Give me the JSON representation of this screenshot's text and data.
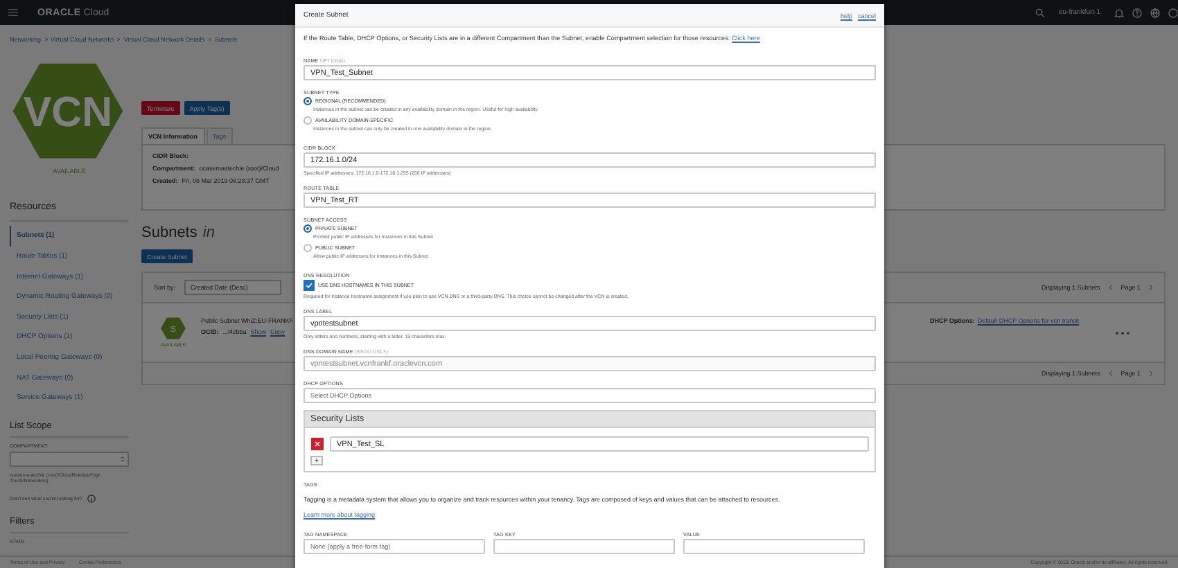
{
  "top_bar": {
    "logo_brand": "ORACLE",
    "logo_product": "Cloud",
    "region": "eu-frankfurt-1"
  },
  "breadcrumb": [
    "Networking",
    "Virtual Cloud Networks",
    "Virtual Cloud Network Details",
    "Subnets"
  ],
  "vcn": {
    "badge": "VCN",
    "status": "AVAILABLE",
    "actions": [
      {
        "label": "Terminate",
        "kind": "danger"
      },
      {
        "label": "Apply Tag(s)",
        "kind": "primary"
      }
    ],
    "tabs": [
      {
        "label": "VCN Information",
        "selected": true
      },
      {
        "label": "Tags",
        "selected": false
      }
    ],
    "info": [
      {
        "label": "CIDR Block:"
      },
      {
        "label": "Compartment:",
        "value": "ocasemastechie (root)/Cloud"
      },
      {
        "label": "Created:",
        "value": "Fri, 08 Mar 2019 08:28:37 GMT"
      }
    ]
  },
  "resources": {
    "title": "Resources",
    "items": [
      {
        "label": "Subnets (1)",
        "selected": true
      },
      {
        "label": "Route Tables (1)",
        "selected": false
      },
      {
        "label": "Internet Gateways (1)",
        "selected": false
      },
      {
        "label": "Dynamic Routing Gateways (0)",
        "selected": false
      },
      {
        "label": "Security Lists (1)",
        "selected": false
      },
      {
        "label": "DHCP Options (1)",
        "selected": false
      },
      {
        "label": "Local Peering Gateways (0)",
        "selected": false
      },
      {
        "label": "NAT Gateways (0)",
        "selected": false
      },
      {
        "label": "Service Gateways (1)",
        "selected": false
      }
    ]
  },
  "list_scope": {
    "title": "List Scope",
    "field_label": "COMPARTMENT",
    "hint": "ocasemastechie (root)/CloudRelease/High Touch/Networking",
    "help": "Don't see what you're looking for?"
  },
  "filters": {
    "title": "Filters",
    "field_label": "STATE"
  },
  "subnets": {
    "title": "Subnets",
    "title_suffix": "in",
    "create": "Create Subnet",
    "sort_label": "Sort by:",
    "sort_value": "Created Date (Desc)",
    "paging_top": "Displaying 1 Subnets",
    "page_top": "Page 1",
    "paging_bottom": "Displaying 1 Subnets",
    "page_bottom": "Page 1",
    "rows": [
      {
        "badge": "S",
        "status": "AVAILABLE",
        "name": "Public Subnet WhiZ:EU-FRANKF",
        "ocid_label": "OCID:",
        "ocid": "...l4zbba",
        "show": "Show",
        "copy": "Copy",
        "dhcp_label": "DHCP Options:",
        "dhcp": "Default DHCP Options for vcn transit"
      }
    ]
  },
  "footer": {
    "links": [
      "Terms of Use and Privacy",
      "Cookie Preferences"
    ],
    "copyright": "Copyright © 2019, Oracle and/or its affiliates. All rights reserved."
  },
  "dialog": {
    "title": "Create Subnet",
    "links": [
      "help",
      "cancel"
    ],
    "notice": "If the Route Table, DHCP Options, or Security Lists are in a different Compartment than the Subnet, enable Compartment selection for those resources:",
    "notice_link": "Click here",
    "name": {
      "label": "NAME",
      "suffix": "OPTIONAL",
      "value": "VPN_Test_Subnet"
    },
    "subnet_type": {
      "label": "SUBNET TYPE",
      "options": [
        {
          "label": "REGIONAL (RECOMMENDED)",
          "hint": "Instances in the subnet can be created in any availability domain in the region. Useful for high availability.",
          "selected": true
        },
        {
          "label": "AVAILABILITY DOMAIN-SPECIFIC",
          "hint": "Instances in the subnet can only be created in one availability domain in the region.",
          "selected": false
        }
      ]
    },
    "cidr": {
      "label": "CIDR BLOCK",
      "value": "172.16.1.0/24",
      "hint": "Specified IP addresses: 172.16.1.0-172.16.1.255 (256 IP addresses)"
    },
    "route_table": {
      "label": "ROUTE TABLE",
      "value": "VPN_Test_RT"
    },
    "subnet_access": {
      "label": "SUBNET ACCESS",
      "options": [
        {
          "label": "PRIVATE SUBNET",
          "hint": "Prohibit public IP addresses for Instances in this Subnet",
          "selected": true
        },
        {
          "label": "PUBLIC SUBNET",
          "hint": "Allow public IP addresses for Instances in this Subnet",
          "selected": false
        }
      ]
    },
    "dns_resolution": {
      "label": "DNS RESOLUTION",
      "option": "USE DNS HOSTNAMES IN THIS SUBNET",
      "checked": true,
      "hint": "Required for instance hostname assignment if you plan to use VCN DNS or a third-party DNS. This choice cannot be changed after the VCN is created."
    },
    "dns_label": {
      "label": "DNS LABEL",
      "value": "vpntestsubnet",
      "hint": "Only letters and numbers, starting with a letter. 15 characters max."
    },
    "dns_domain": {
      "label": "DNS DOMAIN NAME",
      "suffix": "(READ-ONLY)",
      "value": "vpntestsubnet.vcnfrankf.oraclevcn.com"
    },
    "dhcp": {
      "label": "DHCP OPTIONS",
      "value": "Select DHCP Options"
    },
    "security_lists": {
      "title": "Security Lists",
      "items": [
        "VPN_Test_SL"
      ],
      "add": "+"
    },
    "tags": {
      "label": "TAGS",
      "text": "Tagging is a metadata system that allows you to organize and track resources within your tenancy. Tags are composed of keys and values that can be attached to resources.",
      "link": "Learn more about tagging",
      "fields": [
        {
          "label": "TAG NAMESPACE",
          "kind": "select",
          "value": "None (apply a free-form tag)"
        },
        {
          "label": "TAG KEY",
          "kind": "text"
        },
        {
          "label": "VALUE",
          "kind": "text"
        }
      ]
    }
  }
}
